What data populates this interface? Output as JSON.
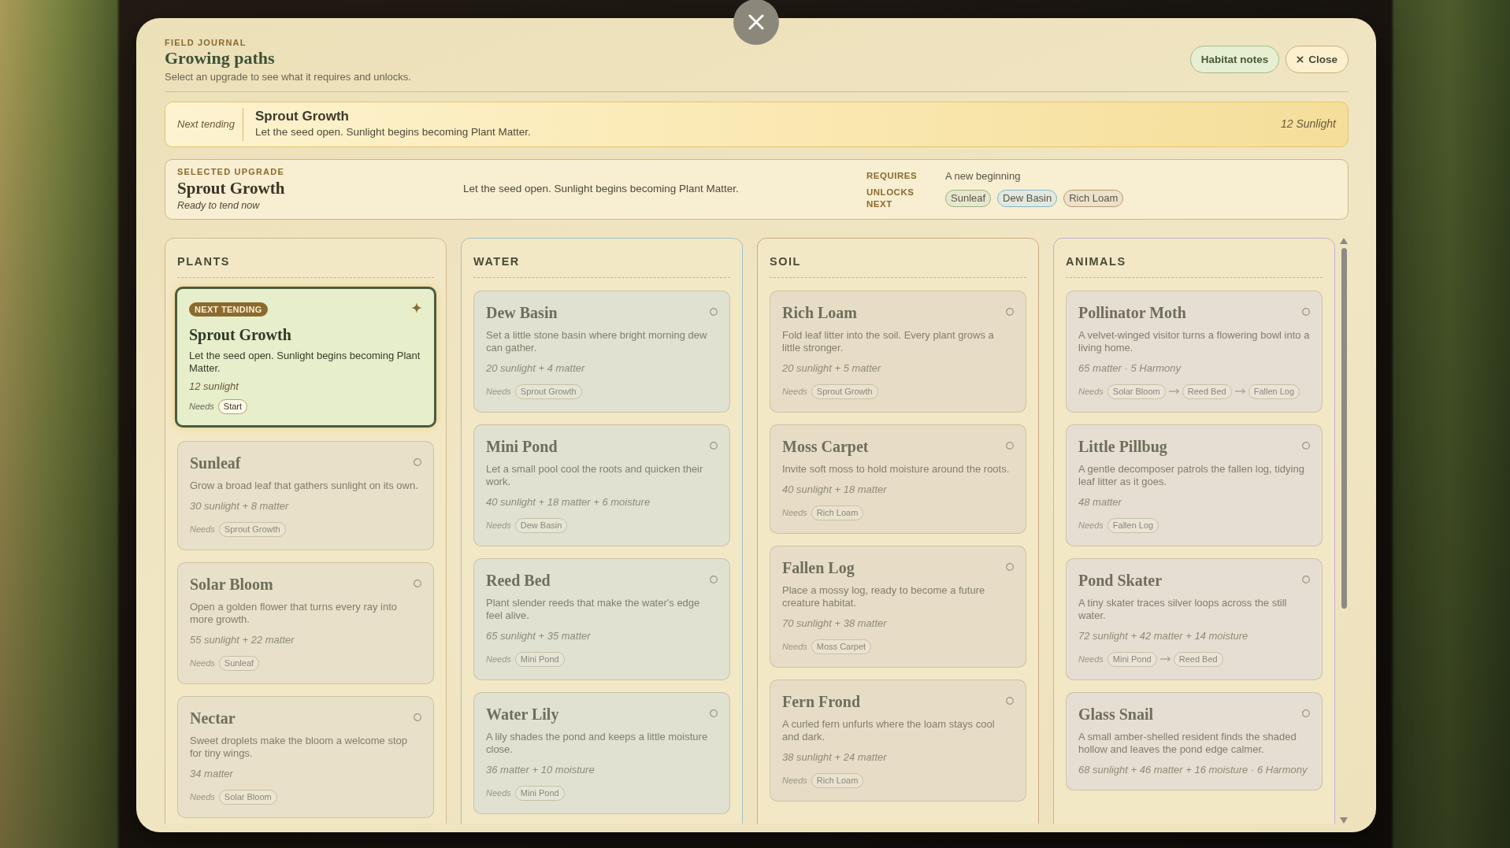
{
  "header": {
    "eyebrow": "FIELD JOURNAL",
    "title": "Growing paths",
    "subtitle": "Select an upgrade to see what it requires and unlocks.",
    "buttons": [
      {
        "label": "Habitat notes",
        "kind": "notes"
      },
      {
        "label": "Close",
        "kind": "close"
      }
    ]
  },
  "next_tending": {
    "label": "Next tending",
    "title": "Sprout Growth",
    "description": "Let the seed open. Sunlight begins becoming Plant Matter.",
    "cost": "12 Sunlight"
  },
  "selected_upgrade": {
    "eyebrow": "SELECTED UPGRADE",
    "title": "Sprout Growth",
    "status": "Ready to tend now",
    "description": "Let the seed open. Sunlight begins becoming Plant Matter.",
    "requires_label": "REQUIRES",
    "requires": "A new beginning",
    "unlocks_label": "UNLOCKS NEXT",
    "unlocks": [
      {
        "label": "Sunleaf",
        "color": "#9fb37f"
      },
      {
        "label": "Dew Basin",
        "color": "#87b8c4"
      },
      {
        "label": "Rich Loam",
        "color": "#b99a70"
      }
    ]
  },
  "columns": [
    {
      "title": "PLANTS",
      "color": "#cdb88e",
      "upgrades": [
        {
          "name": "Sprout Growth",
          "selected": true,
          "badge": "NEXT TENDING",
          "description": "Let the seed open. Sunlight begins becoming Plant Matter.",
          "cost": "12 sunlight",
          "needs_label": "Needs",
          "needs": [
            "Start"
          ]
        },
        {
          "name": "Sunleaf",
          "selected": false,
          "description": "Grow a broad leaf that gathers sunlight on its own.",
          "cost": "30 sunlight + 8 matter",
          "needs_label": "Needs",
          "needs": [
            "Sprout Growth"
          ]
        },
        {
          "name": "Solar Bloom",
          "selected": false,
          "description": "Open a golden flower that turns every ray into more growth.",
          "cost": "55 sunlight + 22 matter",
          "needs_label": "Needs",
          "needs": [
            "Sunleaf"
          ]
        },
        {
          "name": "Nectar",
          "selected": false,
          "description": "Sweet droplets make the bloom a welcome stop for tiny wings.",
          "cost": "34 matter",
          "needs_label": "Needs",
          "needs": [
            "Solar Bloom"
          ]
        }
      ]
    },
    {
      "title": "WATER",
      "color": "#9cc0c8",
      "upgrades": [
        {
          "name": "Dew Basin",
          "selected": false,
          "description": "Set a little stone basin where bright morning dew can gather.",
          "cost": "20 sunlight + 4 matter",
          "needs_label": "Needs",
          "needs": [
            "Sprout Growth"
          ]
        },
        {
          "name": "Mini Pond",
          "selected": false,
          "description": "Let a small pool cool the roots and quicken their work.",
          "cost": "40 sunlight + 18 matter + 6 moisture",
          "needs_label": "Needs",
          "needs": [
            "Dew Basin"
          ]
        },
        {
          "name": "Reed Bed",
          "selected": false,
          "description": "Plant slender reeds that make the water's edge feel alive.",
          "cost": "65 sunlight + 35 matter",
          "needs_label": "Needs",
          "needs": [
            "Mini Pond"
          ]
        },
        {
          "name": "Water Lily",
          "selected": false,
          "description": "A lily shades the pond and keeps a little moisture close.",
          "cost": "36 matter + 10 moisture",
          "needs_label": "Needs",
          "needs": [
            "Mini Pond"
          ]
        }
      ]
    },
    {
      "title": "SOIL",
      "color": "#c9a980",
      "upgrades": [
        {
          "name": "Rich Loam",
          "selected": false,
          "description": "Fold leaf litter into the soil. Every plant grows a little stronger.",
          "cost": "20 sunlight + 5 matter",
          "needs_label": "Needs",
          "needs": [
            "Sprout Growth"
          ]
        },
        {
          "name": "Moss Carpet",
          "selected": false,
          "description": "Invite soft moss to hold moisture around the roots.",
          "cost": "40 sunlight + 18 matter",
          "needs_label": "Needs",
          "needs": [
            "Rich Loam"
          ]
        },
        {
          "name": "Fallen Log",
          "selected": false,
          "description": "Place a mossy log, ready to become a future creature habitat.",
          "cost": "70 sunlight + 38 matter",
          "needs_label": "Needs",
          "needs": [
            "Moss Carpet"
          ]
        },
        {
          "name": "Fern Frond",
          "selected": false,
          "description": "A curled fern unfurls where the loam stays cool and dark.",
          "cost": "38 sunlight + 24 matter",
          "needs_label": "Needs",
          "needs": [
            "Rich Loam"
          ]
        }
      ]
    },
    {
      "title": "ANIMALS",
      "color": "#c2aed4",
      "upgrades": [
        {
          "name": "Pollinator Moth",
          "selected": false,
          "description": "A velvet-winged visitor turns a flowering bowl into a living home.",
          "cost": "65 matter · 5 Harmony",
          "needs_label": "Needs",
          "needs": [
            "Solar Bloom",
            "Reed Bed",
            "Fallen Log"
          ]
        },
        {
          "name": "Little Pillbug",
          "selected": false,
          "description": "A gentle decomposer patrols the fallen log, tidying leaf litter as it goes.",
          "cost": "48 matter",
          "needs_label": "Needs",
          "needs": [
            "Fallen Log"
          ]
        },
        {
          "name": "Pond Skater",
          "selected": false,
          "description": "A tiny skater traces silver loops across the still water.",
          "cost": "72 sunlight + 42 matter + 14 moisture",
          "needs_label": "Needs",
          "needs": [
            "Mini Pond",
            "Reed Bed"
          ]
        },
        {
          "name": "Glass Snail",
          "selected": false,
          "description": "A small amber-shelled resident finds the shaded hollow and leaves the pond edge calmer.",
          "cost": "68 sunlight + 46 matter + 16 moisture · 6 Harmony"
        }
      ]
    }
  ]
}
